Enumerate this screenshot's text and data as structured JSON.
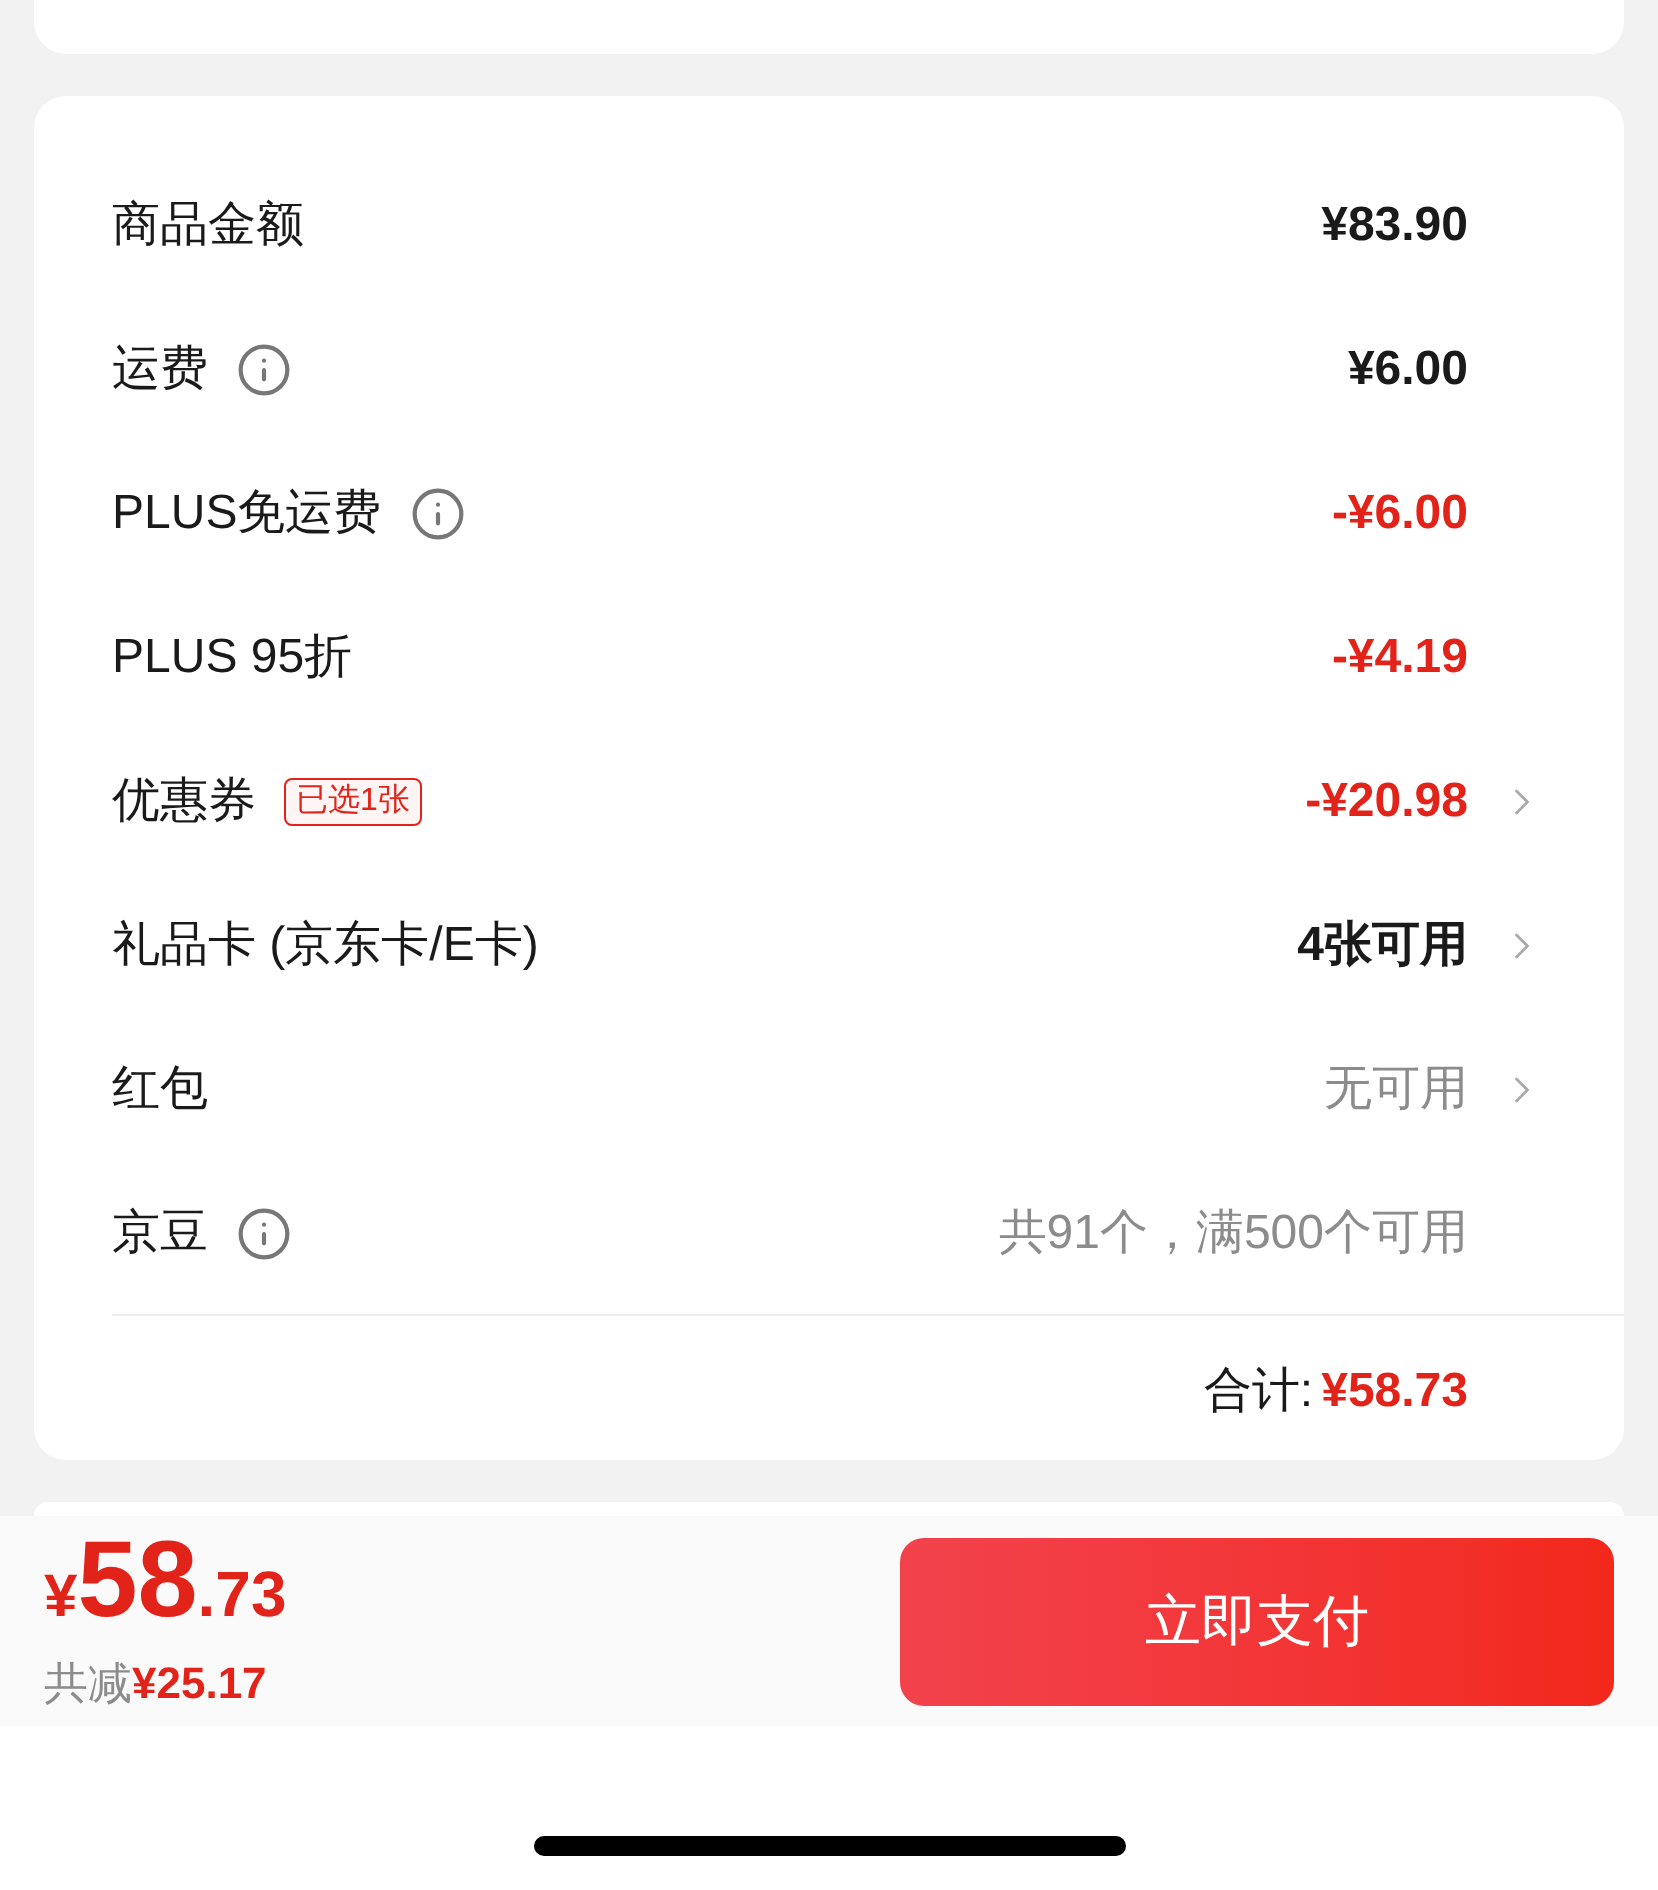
{
  "summary_rows": [
    {
      "label": "商品金额",
      "info": false,
      "value": "¥83.90",
      "kind": "normal",
      "chevron": false
    },
    {
      "label": "运费",
      "info": true,
      "value": "¥6.00",
      "kind": "normal",
      "chevron": false
    },
    {
      "label": "PLUS免运费",
      "info": true,
      "value": "-¥6.00",
      "kind": "discount",
      "chevron": false
    },
    {
      "label": "PLUS 95折",
      "info": false,
      "value": "-¥4.19",
      "kind": "discount",
      "chevron": false
    },
    {
      "label": "优惠券",
      "info": false,
      "badge": "已选1张",
      "value": "-¥20.98",
      "kind": "discount",
      "chevron": true
    },
    {
      "label": "礼品卡 (京东卡/E卡)",
      "info": false,
      "value": "4张可用",
      "kind": "normal",
      "chevron": true
    },
    {
      "label": "红包",
      "info": false,
      "value": "无可用",
      "kind": "muted",
      "chevron": true
    },
    {
      "label": "京豆",
      "info": true,
      "value": "共91个，满500个可用",
      "kind": "muted",
      "chevron": false
    }
  ],
  "total": {
    "label": "合计:",
    "amount": "¥58.73"
  },
  "footer": {
    "price": {
      "currency": "¥",
      "integer": "58",
      "decimal": ".73"
    },
    "savings_label": "共减",
    "savings_amount": "¥25.17",
    "pay_button": "立即支付"
  }
}
